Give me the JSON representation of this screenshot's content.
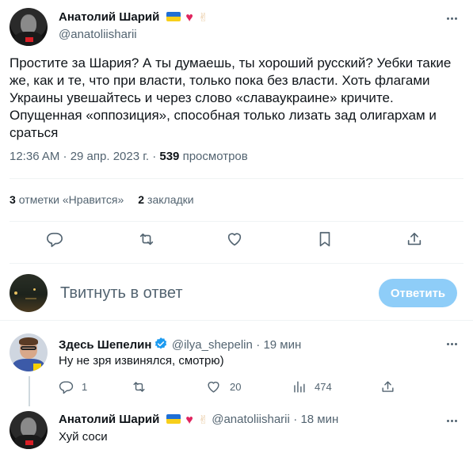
{
  "main_tweet": {
    "author_name": "Анатолий Шарий",
    "author_handle": "@anatoliisharii",
    "text": "Простите за Шария? А ты думаешь, ты хороший русский? Уебки такие же, как и те, что при власти, только пока без власти. Хоть флагами Украины увешайтесь и через слово «славаукраине» кричите. Опущенная «оппозиция», способная только лизать зад олигархам и сраться",
    "time": "12:36 AM · 29 апр. 2023 г. · ",
    "views_count": "539",
    "views_label": " просмотров",
    "likes_count": "3",
    "likes_label": "отметки «Нравится»",
    "bookmarks_count": "2",
    "bookmarks_label": "закладки"
  },
  "compose": {
    "placeholder": "Твитнуть в ответ",
    "button_label": "Ответить"
  },
  "replies": [
    {
      "author_name": "Здесь Шепелин",
      "author_handle": "@ilya_shepelin",
      "time": "· 19 мин",
      "text": "Ну не зря извинялся, смотрю)",
      "reply_count": "1",
      "retweet_count": "",
      "like_count": "20",
      "views_count": "474"
    },
    {
      "author_name": "Анатолий Шарий",
      "author_handle": "@anatoliisharii",
      "time": "· 18 мин",
      "text": "Хуй соси"
    }
  ],
  "colors": {
    "accent": "#1d9bf0",
    "button_disabled": "#8ecdf8",
    "secondary_text": "#536471",
    "like_heart": "#e0245e"
  },
  "icons": [
    "more-icon",
    "reply-icon",
    "retweet-icon",
    "like-icon",
    "bookmark-icon",
    "share-icon",
    "views-icon",
    "verified-icon",
    "flag-icon",
    "heart-emoji-icon",
    "peace-emoji-icon"
  ]
}
